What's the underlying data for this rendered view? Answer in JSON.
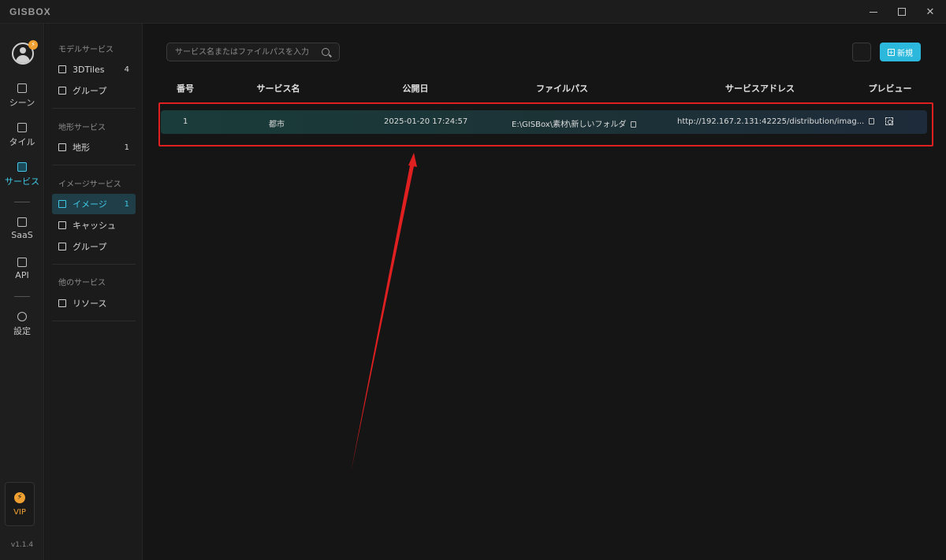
{
  "app": {
    "logo": "GISBOX"
  },
  "window": {
    "close_glyph": "✕"
  },
  "rail": {
    "items": [
      {
        "label": "シーン",
        "icon": "scene-icon"
      },
      {
        "label": "タイル",
        "icon": "tile-icon"
      },
      {
        "label": "サービス",
        "icon": "service-icon",
        "active": true
      },
      {
        "label": "SaaS",
        "icon": "lock-icon"
      },
      {
        "label": "API",
        "icon": "api-icon"
      },
      {
        "label": "設定",
        "icon": "gear-icon"
      }
    ],
    "vip": "VIP",
    "version": "v1.1.4"
  },
  "sidebar": {
    "model": {
      "title": "モデルサービス",
      "items": [
        {
          "label": "3DTiles",
          "count": "4"
        },
        {
          "label": "グループ",
          "count": ""
        }
      ]
    },
    "terrain": {
      "title": "地形サービス",
      "items": [
        {
          "label": "地形",
          "count": "1"
        }
      ]
    },
    "image": {
      "title": "イメージサービス",
      "items": [
        {
          "label": "イメージ",
          "count": "1",
          "active": true
        },
        {
          "label": "キャッシュ",
          "count": ""
        },
        {
          "label": "グループ",
          "count": ""
        }
      ]
    },
    "other": {
      "title": "他のサービス",
      "items": [
        {
          "label": "リソース",
          "count": ""
        }
      ]
    }
  },
  "toolbar": {
    "search_placeholder": "サービス名またはファイルパスを入力",
    "new_label": "新規"
  },
  "table": {
    "columns": [
      "番号",
      "サービス名",
      "公開日",
      "ファイルパス",
      "サービスアドレス",
      "プレビュー"
    ],
    "rows": [
      {
        "id": "1",
        "name": "都市",
        "date": "2025-01-20 17:24:57",
        "path": "E:\\GISBox\\素材\\新しいフォルダ",
        "address": "http://192.167.2.131:42225/distribution/imag..."
      }
    ]
  },
  "colors": {
    "accent": "#3fc8e6",
    "highlight": "#e02020",
    "vip": "#f0a030"
  }
}
